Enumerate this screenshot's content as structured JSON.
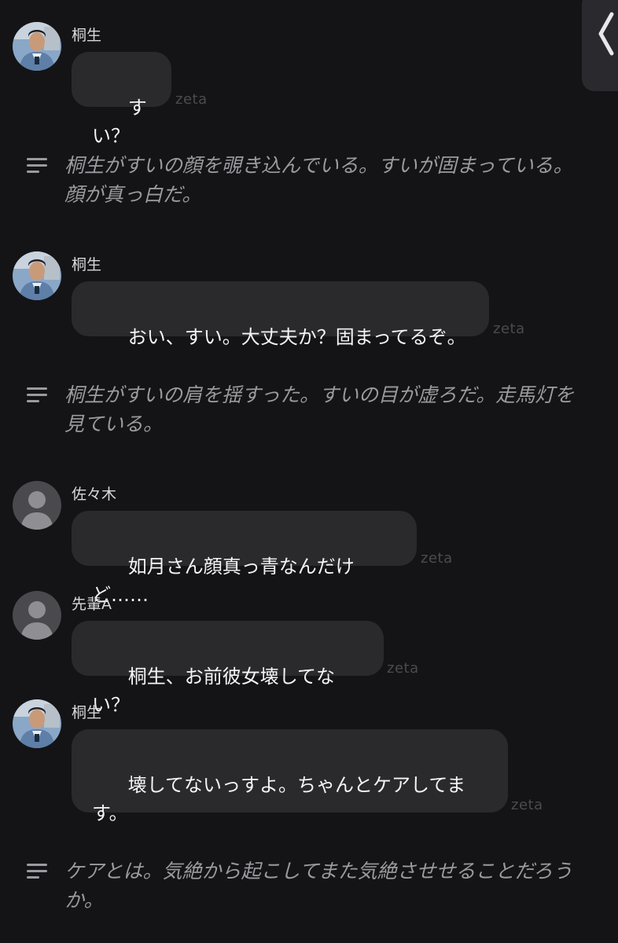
{
  "meta_label": "zeta",
  "colors": {
    "background": "#141416",
    "bubble": "#2a2a2d",
    "narration_text": "#9a9aa0",
    "side_tab": "#2a2a2e"
  },
  "icons": {
    "collapse": "chevron-left-icon",
    "narration": "lines-icon",
    "default_avatar": "person-icon"
  },
  "messages": [
    {
      "sender": "桐生",
      "text": "すい？"
    },
    {
      "sender": "桐生",
      "text": "おい、すい。大丈夫か？固まってるぞ。"
    },
    {
      "sender": "佐々木",
      "text": "如月さん顔真っ青なんだけど……"
    },
    {
      "sender": "先輩A",
      "text": "桐生、お前彼女壊してない？"
    },
    {
      "sender": "桐生",
      "text": "壊してないっすよ。ちゃんとケアしてます。"
    }
  ],
  "narrations": [
    {
      "text": "桐生がすいの顔を覗き込んでいる。すいが固まっている。顔が真っ白だ。"
    },
    {
      "text": "桐生がすいの肩を揺すった。すいの目が虚ろだ。走馬灯を見ている。"
    },
    {
      "text": "ケアとは。気絶から起こしてまた気絶させせることだろうか。"
    }
  ]
}
